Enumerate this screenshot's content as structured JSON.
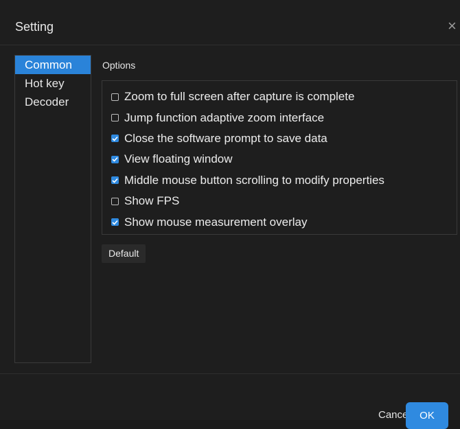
{
  "dialog": {
    "title": "Setting",
    "close_icon": "close-icon"
  },
  "sidebar": {
    "items": [
      {
        "label": "Common",
        "active": true
      },
      {
        "label": "Hot key",
        "active": false
      },
      {
        "label": "Decoder",
        "active": false
      }
    ]
  },
  "options": {
    "label": "Options",
    "items": [
      {
        "label": "Zoom to full screen after capture is complete",
        "checked": false
      },
      {
        "label": "Jump function adaptive zoom interface",
        "checked": false
      },
      {
        "label": "Close the software prompt to save data",
        "checked": true
      },
      {
        "label": "View floating window",
        "checked": true
      },
      {
        "label": "Middle mouse button scrolling to modify properties",
        "checked": true
      },
      {
        "label": "Show FPS",
        "checked": false
      },
      {
        "label": "Show mouse measurement overlay",
        "checked": true
      }
    ]
  },
  "buttons": {
    "default": "Default",
    "cancel": "Cancel",
    "ok": "OK"
  },
  "colors": {
    "accent": "#2f8ae0",
    "background": "#1e1e1e",
    "border": "#3a3a3a"
  }
}
